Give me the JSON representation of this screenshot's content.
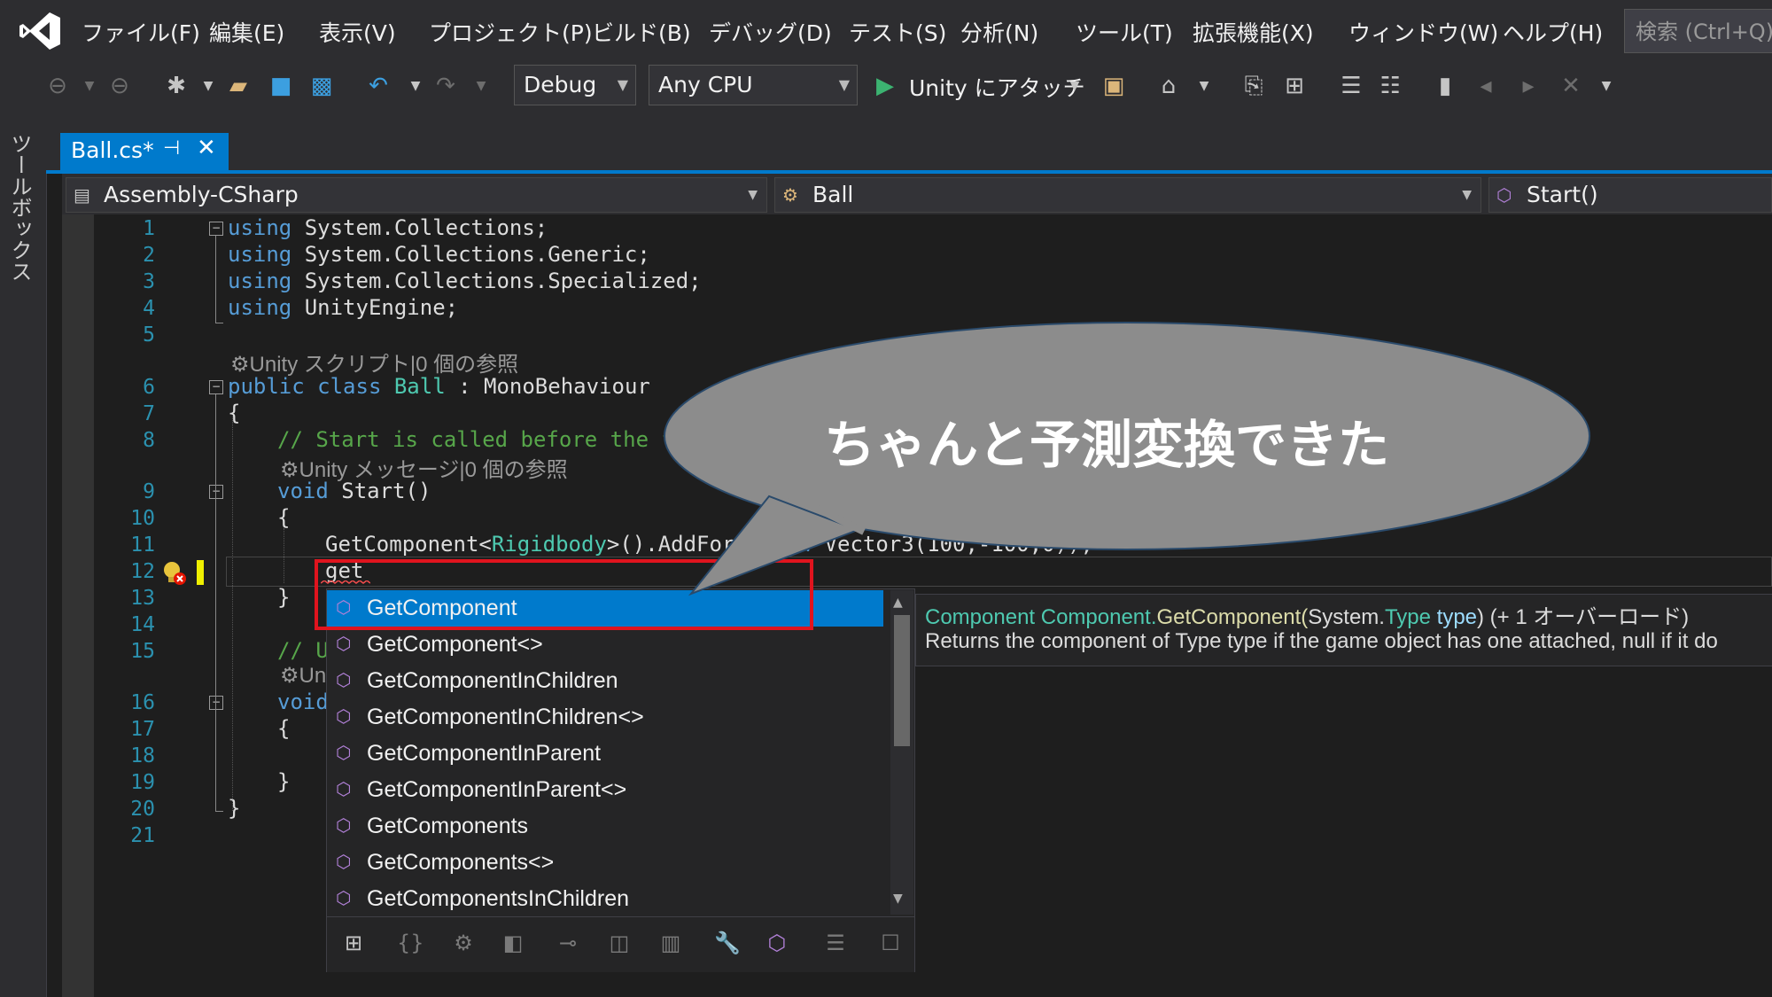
{
  "menu": [
    "ファイル(F)",
    "編集(E)",
    "表示(V)",
    "プロジェクト(P)",
    "ビルド(B)",
    "デバッグ(D)",
    "テスト(S)",
    "分析(N)",
    "ツール(T)",
    "拡張機能(X)",
    "ウィンドウ(W)",
    "ヘルプ(H)"
  ],
  "search": {
    "placeholder": "検索 (Ctrl+Q)"
  },
  "toolbar": {
    "config": "Debug",
    "platform": "Any CPU",
    "attach": "Unity にアタッチ"
  },
  "toolbox": {
    "label": "ツールボックス"
  },
  "tab": {
    "title": "Ball.cs*",
    "pin": "⊣",
    "close": "✕"
  },
  "nav": {
    "project": "Assembly-CSharp",
    "class": "Ball",
    "member": "Start()"
  },
  "code": {
    "line_numbers": [
      "1",
      "2",
      "3",
      "4",
      "5",
      "6",
      "7",
      "8",
      "9",
      "10",
      "11",
      "12",
      "13",
      "14",
      "15",
      "16",
      "17",
      "18",
      "19",
      "20",
      "21"
    ],
    "l1a": "using",
    "l1b": " System.Collections;",
    "l2a": "using",
    "l2b": " System.Collections.Generic;",
    "l3a": "using",
    "l3b": " System.Collections.Specialized;",
    "l4a": "using",
    "l4b": " UnityEngine;",
    "lens1": "Unity スクリプト|0 個の参照",
    "l6a": "public",
    "l6b": " class",
    "l6c": " Ball",
    "l6d": " : MonoBehaviour",
    "l7": "{",
    "l8": "// Start is called before the first frame update",
    "lens2": "Unity メッセージ|0 個の参照",
    "l9a": "void",
    "l9b": " Start()",
    "l10": "{",
    "l11a": "GetComponent<",
    "l11b": "Rigidbody",
    "l11c": ">().AddForce(",
    "l11d": "new",
    "l11e": " Vector3(100,-100,0));",
    "l12": "get",
    "l13": "}",
    "l15": "// U",
    "lens3": "Un",
    "l16": "void",
    "l17": "{",
    "l19": "}",
    "l20": "}"
  },
  "completion": {
    "items": [
      "GetComponent",
      "GetComponent<>",
      "GetComponentInChildren",
      "GetComponentInChildren<>",
      "GetComponentInParent",
      "GetComponentInParent<>",
      "GetComponents",
      "GetComponents<>",
      "GetComponentsInChildren"
    ],
    "selected": "GetComponent"
  },
  "tooltip": {
    "sig_type": "Component",
    "sig_class": " Component.",
    "sig_method": "GetComponent(",
    "sig_ns": "System.",
    "sig_ptype": "Type",
    "sig_pname": " type",
    "sig_tail": ") (+ 1 オーバーロード)",
    "desc": "Returns the component of Type type if the game object has one attached, null if it do"
  },
  "callout": {
    "text": "ちゃんと予測変換できた"
  },
  "colors": {
    "accent": "#007acc",
    "highlight": "#e0141e",
    "bubble": "#8c8c8c"
  }
}
